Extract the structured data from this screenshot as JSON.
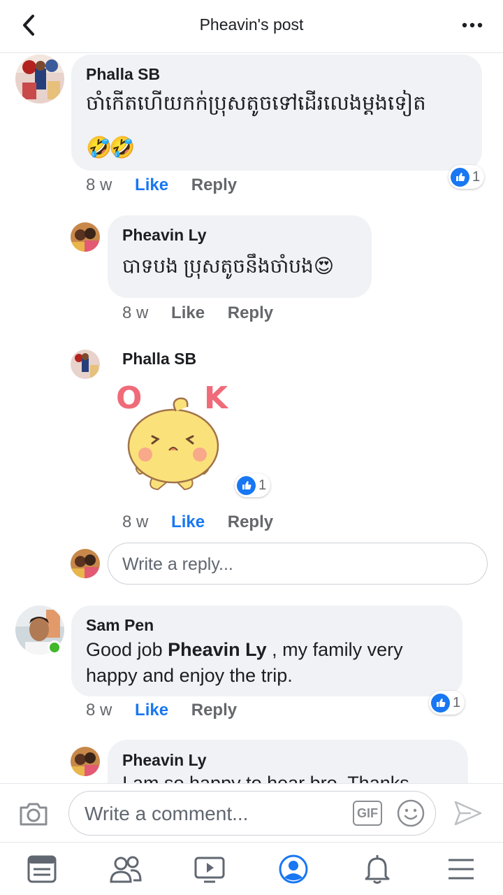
{
  "header": {
    "title": "Pheavin's post",
    "back_icon": "chevron-left-icon",
    "more_icon": "more-icon"
  },
  "comments": [
    {
      "author": "Phalla SB",
      "text": "ចាំកើតហើយកក់ប្រុសតូចទៅដើរលេងម្តងទៀត",
      "emoji": "🤣🤣",
      "time": "8 w",
      "like_label": "Like",
      "reply_label": "Reply",
      "reactions": "1"
    },
    {
      "author": "Pheavin Ly",
      "text": "បាទបង ប្រុសតូចនឹងចាំបង😍",
      "time": "8 w",
      "like_label": "Like",
      "reply_label": "Reply"
    },
    {
      "author": "Phalla SB",
      "sticker_text": [
        "O",
        "K"
      ],
      "time": "8 w",
      "like_label": "Like",
      "reply_label": "Reply",
      "reactions": "1"
    },
    {
      "author": "Sam Pen",
      "text_before": "Good job ",
      "mention": "Pheavin Ly",
      "text_after": " , my family very happy and enjoy the trip.",
      "time": "8 w",
      "like_label": "Like",
      "reply_label": "Reply",
      "reactions": "1"
    },
    {
      "author": "Pheavin Ly",
      "text": "I am so happy to hear bro. Thanks"
    }
  ],
  "reply_input": {
    "placeholder": "Write a reply..."
  },
  "composer": {
    "placeholder": "Write a comment...",
    "gif_label": "GIF"
  },
  "colors": {
    "accent": "#1877f2",
    "bubble": "#f0f2f5",
    "secondary_text": "#65676b",
    "online": "#42b72a"
  },
  "tabbar": {
    "items": [
      "news-feed-icon",
      "friends-icon",
      "watch-icon",
      "profile-icon",
      "notifications-icon",
      "menu-icon"
    ],
    "active": "profile-icon"
  }
}
